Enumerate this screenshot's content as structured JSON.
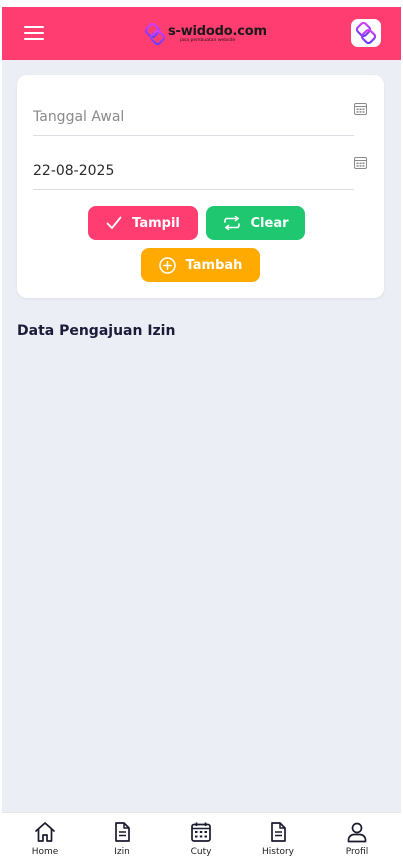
{
  "header": {
    "brand_name": "s-widodo.com",
    "brand_tagline": "jasa pembuatan website",
    "accent_color": "#ff3d71"
  },
  "filter": {
    "start_date_placeholder": "Tanggal Awal",
    "start_date_value": "",
    "end_date_value": "22-08-2025",
    "tampil_label": "Tampil",
    "clear_label": "Clear",
    "tambah_label": "Tambah",
    "colors": {
      "tampil": "#ff3d71",
      "clear": "#1fc870",
      "tambah": "#ffaa00"
    }
  },
  "section": {
    "title": "Data Pengajuan Izin"
  },
  "nav": {
    "items": [
      {
        "label": "Home",
        "icon": "home-icon"
      },
      {
        "label": "Izin",
        "icon": "document-icon"
      },
      {
        "label": "Cuty",
        "icon": "calendar-icon"
      },
      {
        "label": "History",
        "icon": "history-document-icon"
      },
      {
        "label": "Profil",
        "icon": "user-icon"
      }
    ]
  }
}
